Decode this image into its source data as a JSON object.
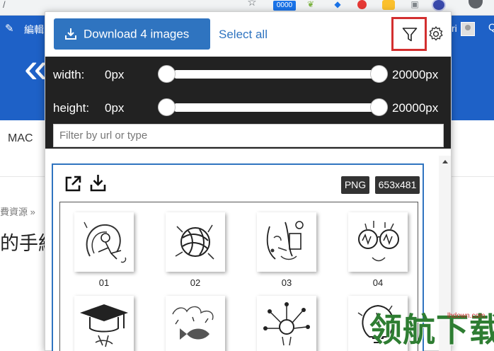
{
  "browser": {
    "url_fragment": "/",
    "counter_badge": "0000"
  },
  "page": {
    "edit_label": "編輯",
    "header_letter": "ri",
    "nav_item": "MAC",
    "nav_partial": "Q",
    "breadcrumb": "費資源 »",
    "article_title": "的手繪"
  },
  "popup": {
    "download_label": "Download 4 images",
    "select_all_label": "Select all",
    "filters": {
      "width_label": "width:",
      "width_min": "0px",
      "width_max": "20000px",
      "height_label": "height:",
      "height_min": "0px",
      "height_max": "20000px",
      "url_placeholder": "Filter by url or type",
      "url_value": ""
    },
    "card": {
      "type_tag": "PNG",
      "size_tag": "653x481"
    },
    "thumbnails": [
      {
        "label": "01"
      },
      {
        "label": "02"
      },
      {
        "label": "03"
      },
      {
        "label": "04"
      },
      {
        "label": ""
      },
      {
        "label": ""
      },
      {
        "label": ""
      },
      {
        "label": ""
      }
    ]
  },
  "watermark": {
    "url": "lhdown.com",
    "brand": "领航下载"
  },
  "colors": {
    "primary": "#2f74c0",
    "header_blue": "#1e61c7",
    "panel_dark": "#222222",
    "highlight_red": "#d32f2f",
    "watermark_green": "#2e7d32"
  }
}
